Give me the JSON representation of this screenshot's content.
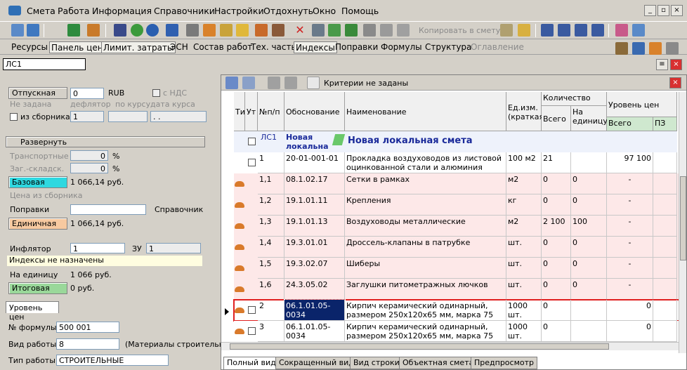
{
  "menu": [
    "Смета",
    "Работа",
    "Информация",
    "Справочники",
    "Настройки",
    "Отдохнуть",
    "Окно",
    "Помощь"
  ],
  "window_buttons": [
    "_",
    "▫",
    "×"
  ],
  "toolbar": {
    "copy_label": "Копировать в смету"
  },
  "tabs": [
    {
      "label": "Ресурсы",
      "state": "normal"
    },
    {
      "label": "Панель цен",
      "state": "selected"
    },
    {
      "label": "Лимит. затраты",
      "state": "selected"
    },
    {
      "label": "ЭСН",
      "state": "normal"
    },
    {
      "label": "Состав работ",
      "state": "normal"
    },
    {
      "label": "Тех. часть",
      "state": "normal"
    },
    {
      "label": "Индексы",
      "state": "selected"
    },
    {
      "label": "Поправки",
      "state": "normal"
    },
    {
      "label": "Формулы",
      "state": "normal"
    },
    {
      "label": "Структура",
      "state": "normal"
    },
    {
      "label": "Оглавление",
      "state": "disabled"
    }
  ],
  "id_field": "ЛС1",
  "left": {
    "otpusk_btn": "Отпускная",
    "otpusk_val": "0",
    "currency": "RUB",
    "nds_label": "с НДС",
    "not_set": "Не задана",
    "deflator": "дефлятор",
    "by_rate": "по курсу",
    "rate_date": "дата курса",
    "from_collection": "из сборника",
    "deflator_val": "1",
    "date_val": ". .",
    "expand": "Развернуть",
    "transport": "Транспортные",
    "transport_val": "0",
    "pct": "%",
    "storage": "Заг.-складск.",
    "storage_val": "0",
    "base_btn": "Базовая",
    "base_val": "1 066,14 руб.",
    "collection_price": "Цена из сборника",
    "corrections": "Поправки",
    "reference": "Справочник",
    "unit_btn": "Единичная",
    "unit_val": "1 066,14 руб.",
    "inflator": "Инфлятор",
    "inflator_val": "1",
    "zu": "ЗУ",
    "zu_val": "1",
    "indexes_note": "Индексы не назначены",
    "per_unit": "На единицу",
    "per_unit_val": "1 066 руб.",
    "total_btn": "Итоговая",
    "total_val": "0 руб.",
    "price_level_tab": "Уровень цен",
    "formula_label": "№ формулы",
    "formula_val": "500 001",
    "work_type_label": "Вид работы",
    "work_type_val": "8",
    "work_type_desc": "(Материалы строительн...",
    "work_kind_label": "Тип работы",
    "work_kind_val": "СТРОИТЕЛЬНЫЕ"
  },
  "grid": {
    "criteria": "Критерии не заданы",
    "headers": {
      "ti": "Ти",
      "ut": "Ут",
      "num": "№п/п",
      "basis": "Обоснование",
      "name": "Наименование",
      "unit": "Ед.изм. (краткая)",
      "qty": "Количество",
      "qty_total": "Всего",
      "qty_per": "На единицу",
      "price": "Уровень цен",
      "price_total": "Всего",
      "pz": "ПЗ"
    },
    "title_row": {
      "num": "ЛС1",
      "basis": "Новая локальна",
      "name": "Новая локальная смета"
    },
    "rows": [
      {
        "num": "1",
        "basis": "20-01-001-01",
        "name": "Прокладка воздуховодов из листовой оцинкованной стали и алюминия класса Н",
        "unit": "100 м2",
        "qty": "21",
        "per": "",
        "total": "97 100",
        "kind": "main"
      },
      {
        "num": "1,1",
        "basis": "08.1.02.17",
        "name": "Сетки в рамках",
        "unit": "м2",
        "qty": "0",
        "per": "0",
        "total": "-",
        "kind": "res"
      },
      {
        "num": "1,2",
        "basis": "19.1.01.11",
        "name": "Крепления",
        "unit": "кг",
        "qty": "0",
        "per": "0",
        "total": "-",
        "kind": "res"
      },
      {
        "num": "1,3",
        "basis": "19.1.01.13",
        "name": "Воздуховоды металлические",
        "unit": "м2",
        "qty": "2 100",
        "per": "100",
        "total": "-",
        "kind": "res"
      },
      {
        "num": "1,4",
        "basis": "19.3.01.01",
        "name": "Дроссель-клапаны в патрубке",
        "unit": "шт.",
        "qty": "0",
        "per": "0",
        "total": "-",
        "kind": "res"
      },
      {
        "num": "1,5",
        "basis": "19.3.02.07",
        "name": "Шиберы",
        "unit": "шт.",
        "qty": "0",
        "per": "0",
        "total": "-",
        "kind": "res"
      },
      {
        "num": "1,6",
        "basis": "24.3.05.02",
        "name": "Заглушки питометражных лючков",
        "unit": "шт.",
        "qty": "0",
        "per": "0",
        "total": "-",
        "kind": "res"
      },
      {
        "num": "2",
        "basis": "06.1.01.05-0034",
        "name": "Кирпич керамический одинарный, размером 250x120x65 мм, марка 75",
        "unit": "1000 шт.",
        "qty": "0",
        "per": "",
        "total": "0",
        "kind": "selected"
      },
      {
        "num": "3",
        "basis": "06.1.01.05-0034",
        "name": "Кирпич керамический одинарный, размером 250x120x65 мм, марка 75",
        "unit": "1000 шт.",
        "qty": "0",
        "per": "",
        "total": "0",
        "kind": "main2"
      }
    ]
  },
  "bottom_tabs": [
    "Полный вид",
    "Сокращенный вид",
    "Вид строки",
    "Объектная смета",
    "Предпросмотр"
  ]
}
